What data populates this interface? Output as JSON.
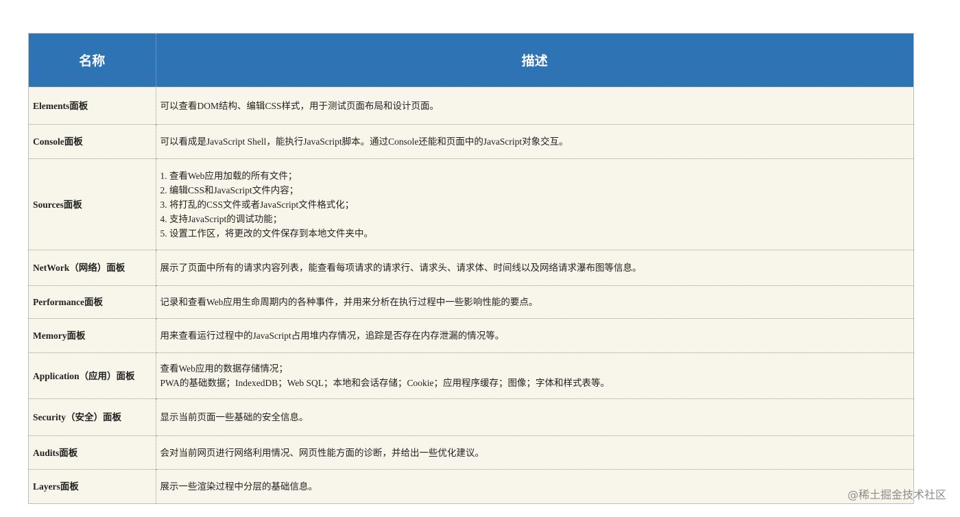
{
  "header": {
    "name": "名称",
    "desc": "描述"
  },
  "rows": [
    {
      "name": "Elements面板",
      "desc": [
        "可以查看DOM结构、编辑CSS样式，用于测试页面布局和设计页面。"
      ]
    },
    {
      "name": "Console面板",
      "desc": [
        "可以看成是JavaScript Shell，能执行JavaScript脚本。通过Console还能和页面中的JavaScript对象交互。"
      ]
    },
    {
      "name": "Sources面板",
      "desc": [
        "1. 查看Web应用加载的所有文件；",
        "2. 编辑CSS和JavaScript文件内容；",
        "3. 将打乱的CSS文件或者JavaScript文件格式化；",
        "4. 支持JavaScript的调试功能；",
        "5. 设置工作区，将更改的文件保存到本地文件夹中。"
      ]
    },
    {
      "name": "NetWork（网络）面板",
      "desc": [
        "展示了页面中所有的请求内容列表，能查看每项请求的请求行、请求头、请求体、时间线以及网络请求瀑布图等信息。"
      ]
    },
    {
      "name": "Performance面板",
      "desc": [
        "记录和查看Web应用生命周期内的各种事件，并用来分析在执行过程中一些影响性能的要点。"
      ]
    },
    {
      "name": "Memory面板",
      "desc": [
        "用来查看运行过程中的JavaScript占用堆内存情况，追踪是否存在内存泄漏的情况等。"
      ]
    },
    {
      "name": "Application（应用）面板",
      "desc": [
        "查看Web应用的数据存储情况；",
        "PWA的基础数据；IndexedDB；Web SQL；本地和会话存储；Cookie；应用程序缓存；图像；字体和样式表等。"
      ]
    },
    {
      "name": "Security（安全）面板",
      "desc": [
        "显示当前页面一些基础的安全信息。"
      ]
    },
    {
      "name": "Audits面板",
      "desc": [
        "会对当前网页进行网络利用情况、网页性能方面的诊断，并给出一些优化建议。"
      ]
    },
    {
      "name": "Layers面板",
      "desc": [
        "展示一些渲染过程中分层的基础信息。"
      ]
    }
  ],
  "row_heights": [
    54,
    49,
    132,
    51,
    47,
    49,
    66,
    53,
    48,
    49
  ],
  "watermark": "@稀土掘金技术社区"
}
